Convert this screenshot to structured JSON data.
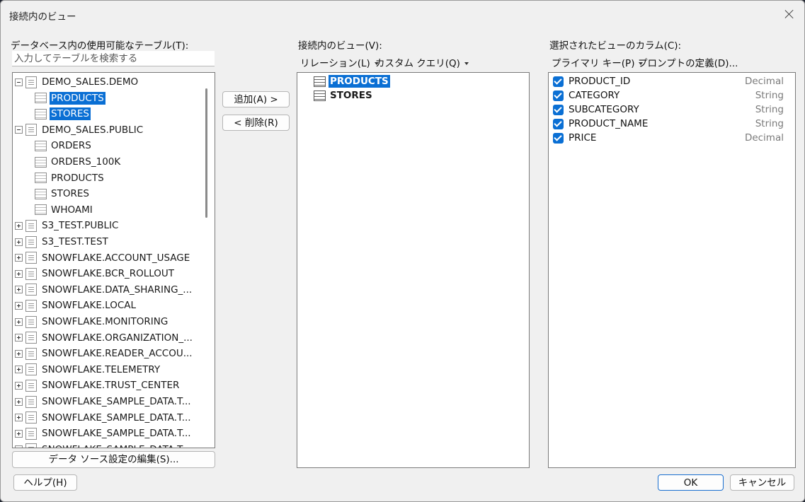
{
  "window": {
    "title": "接続内のビュー"
  },
  "available": {
    "label": "データベース内の使用可能なテーブル(T):",
    "search_placeholder": "入力してテーブルを検索する",
    "tree": [
      {
        "label": "DEMO_SALES.DEMO",
        "kind": "schema",
        "expander": "minus",
        "depth": 0
      },
      {
        "label": "PRODUCTS",
        "kind": "table",
        "depth": 1,
        "selected": true
      },
      {
        "label": "STORES",
        "kind": "table",
        "depth": 1,
        "selected": true
      },
      {
        "label": "DEMO_SALES.PUBLIC",
        "kind": "schema",
        "expander": "minus",
        "depth": 0
      },
      {
        "label": "ORDERS",
        "kind": "table",
        "depth": 1
      },
      {
        "label": "ORDERS_100K",
        "kind": "table",
        "depth": 1
      },
      {
        "label": "PRODUCTS",
        "kind": "table",
        "depth": 1
      },
      {
        "label": "STORES",
        "kind": "table",
        "depth": 1
      },
      {
        "label": "WHOAMI",
        "kind": "table",
        "depth": 1
      },
      {
        "label": "S3_TEST.PUBLIC",
        "kind": "schema",
        "expander": "plus",
        "depth": 0
      },
      {
        "label": "S3_TEST.TEST",
        "kind": "schema",
        "expander": "plus",
        "depth": 0
      },
      {
        "label": "SNOWFLAKE.ACCOUNT_USAGE",
        "kind": "schema",
        "expander": "plus",
        "depth": 0
      },
      {
        "label": "SNOWFLAKE.BCR_ROLLOUT",
        "kind": "schema",
        "expander": "plus",
        "depth": 0
      },
      {
        "label": "SNOWFLAKE.DATA_SHARING_...",
        "kind": "schema",
        "expander": "plus",
        "depth": 0
      },
      {
        "label": "SNOWFLAKE.LOCAL",
        "kind": "schema",
        "expander": "plus",
        "depth": 0
      },
      {
        "label": "SNOWFLAKE.MONITORING",
        "kind": "schema",
        "expander": "plus",
        "depth": 0
      },
      {
        "label": "SNOWFLAKE.ORGANIZATION_...",
        "kind": "schema",
        "expander": "plus",
        "depth": 0
      },
      {
        "label": "SNOWFLAKE.READER_ACCOU...",
        "kind": "schema",
        "expander": "plus",
        "depth": 0
      },
      {
        "label": "SNOWFLAKE.TELEMETRY",
        "kind": "schema",
        "expander": "plus",
        "depth": 0
      },
      {
        "label": "SNOWFLAKE.TRUST_CENTER",
        "kind": "schema",
        "expander": "plus",
        "depth": 0
      },
      {
        "label": "SNOWFLAKE_SAMPLE_DATA.T...",
        "kind": "schema",
        "expander": "plus",
        "depth": 0
      },
      {
        "label": "SNOWFLAKE_SAMPLE_DATA.T...",
        "kind": "schema",
        "expander": "plus",
        "depth": 0
      },
      {
        "label": "SNOWFLAKE_SAMPLE_DATA.T...",
        "kind": "schema",
        "expander": "plus",
        "depth": 0
      },
      {
        "label": "SNOWFLAKE_SAMPLE_DATA.T...",
        "kind": "schema",
        "expander": "plus",
        "depth": 0
      }
    ],
    "edit_source_label": "データ ソース設定の編集(S)..."
  },
  "transfer": {
    "add_label": "追加(A) >",
    "remove_label": "< 削除(R)"
  },
  "views": {
    "label": "接続内のビュー(V):",
    "relation_menu": "リレーション(L)",
    "custom_query_menu": "カスタム クエリ(Q)",
    "items": [
      {
        "label": "PRODUCTS",
        "selected": true
      },
      {
        "label": "STORES",
        "selected": false
      }
    ]
  },
  "columns": {
    "label": "選択されたビューのカラム(C):",
    "primary_key_menu": "プライマリ キー(P)",
    "prompt_def_menu": "プロンプトの定義(D)...",
    "items": [
      {
        "name": "PRODUCT_ID",
        "type": "Decimal",
        "checked": true
      },
      {
        "name": "CATEGORY",
        "type": "String",
        "checked": true
      },
      {
        "name": "SUBCATEGORY",
        "type": "String",
        "checked": true
      },
      {
        "name": "PRODUCT_NAME",
        "type": "String",
        "checked": true
      },
      {
        "name": "PRICE",
        "type": "Decimal",
        "checked": true
      }
    ]
  },
  "footer": {
    "help_label": "ヘルプ(H)",
    "ok_label": "OK",
    "cancel_label": "キャンセル"
  },
  "colors": {
    "selection": "#0a6fd4",
    "primary_border": "#1a6fd0",
    "dialog_bg": "#f0f0f0"
  }
}
